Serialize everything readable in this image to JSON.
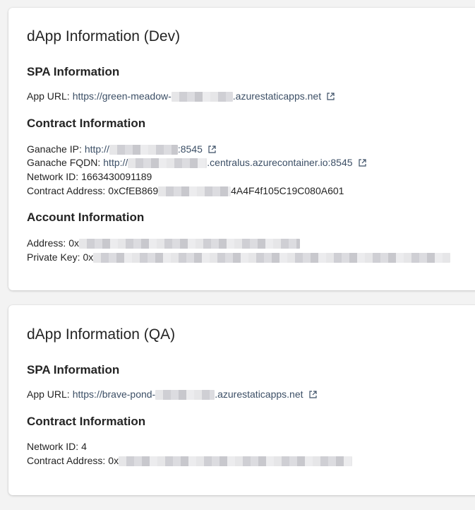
{
  "dev": {
    "title": "dApp Information (Dev)",
    "spa": {
      "heading": "SPA Information",
      "app_url_label": "App URL:",
      "app_url_prefix": "https://green-meadow-",
      "app_url_suffix": ".azurestaticapps.net"
    },
    "contract": {
      "heading": "Contract Information",
      "ganache_ip_label": "Ganache IP:",
      "ganache_ip_prefix": "http://",
      "ganache_ip_suffix": ":8545",
      "ganache_fqdn_label": "Ganache FQDN:",
      "ganache_fqdn_prefix": "http://",
      "ganache_fqdn_suffix": ".centralus.azurecontainer.io:8545",
      "network_id_label": "Network ID:",
      "network_id": "1663430091189",
      "contract_address_label": "Contract Address:",
      "contract_address_prefix": "0xCfEB869",
      "contract_address_suffix": "4A4F4f105C19C080A601"
    },
    "account": {
      "heading": "Account Information",
      "address_label": "Address:",
      "address_prefix": "0x",
      "private_key_label": "Private Key:",
      "private_key_prefix": "0x"
    }
  },
  "qa": {
    "title": "dApp Information (QA)",
    "spa": {
      "heading": "SPA Information",
      "app_url_label": "App URL:",
      "app_url_prefix": "https://brave-pond-",
      "app_url_suffix": ".azurestaticapps.net"
    },
    "contract": {
      "heading": "Contract Information",
      "network_id_label": "Network ID:",
      "network_id": "4",
      "contract_address_label": "Contract Address:",
      "contract_address_prefix": "0x"
    }
  },
  "colors": {
    "background": "#f3f3f3",
    "card": "#ffffff",
    "text": "#242424",
    "link": "#3c4f66"
  },
  "icons": {
    "external_link": "open-in-new-icon"
  }
}
